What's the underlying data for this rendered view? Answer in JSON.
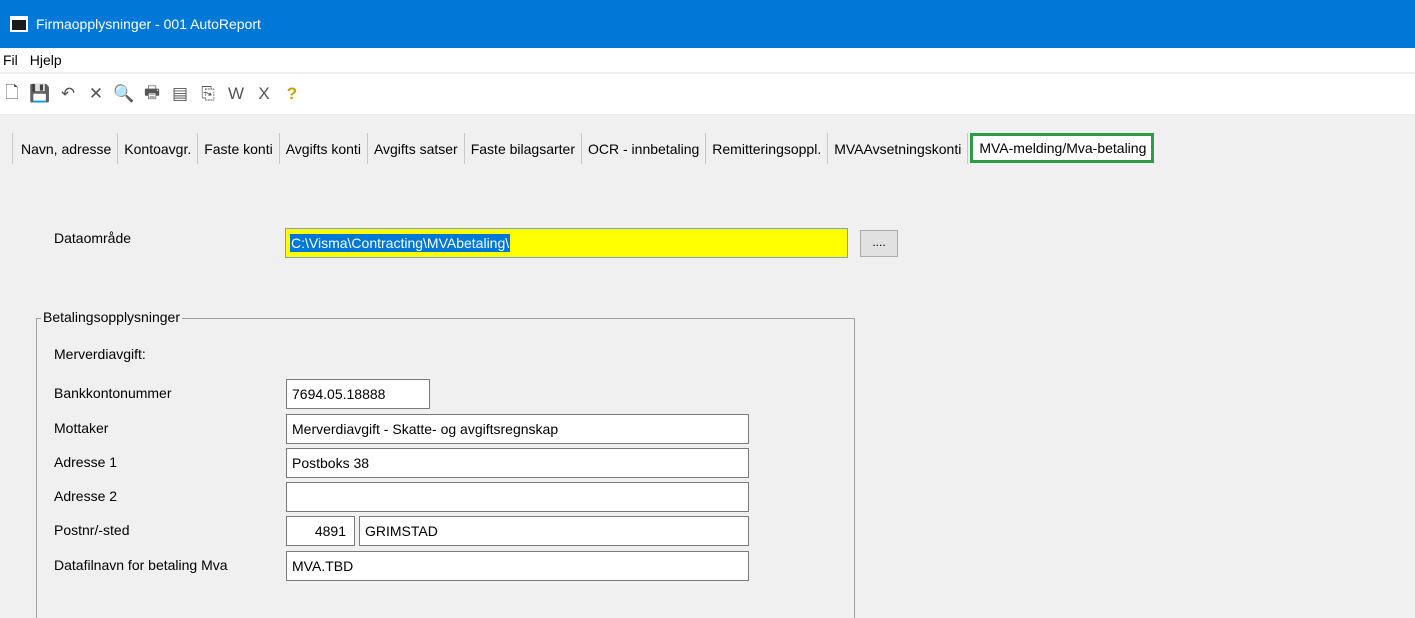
{
  "window": {
    "title": "Firmaopplysninger - 001 AutoReport"
  },
  "menu": [
    "Fil",
    "Hjelp"
  ],
  "toolbar": [
    {
      "name": "new-icon",
      "glyph": "🗋"
    },
    {
      "name": "save-icon",
      "glyph": "💾"
    },
    {
      "name": "undo-icon",
      "glyph": "↶"
    },
    {
      "name": "delete-icon",
      "glyph": "✕"
    },
    {
      "name": "find-icon",
      "glyph": "🔍"
    },
    {
      "name": "print-icon",
      "glyph": "🖶"
    },
    {
      "name": "form-icon",
      "glyph": "▤"
    },
    {
      "name": "copy-icon",
      "glyph": "⎘"
    },
    {
      "name": "word-icon",
      "glyph": "W"
    },
    {
      "name": "excel-icon",
      "glyph": "X"
    },
    {
      "name": "help-icon",
      "glyph": "?"
    }
  ],
  "tabs": [
    "Navn, adresse",
    "Kontoavgr.",
    "Faste konti",
    "Avgifts konti",
    "Avgifts satser",
    "Faste bilagsarter",
    "OCR - innbetaling",
    "Remitteringsoppl.",
    "MVAAvsetningskonti",
    "MVA-melding/Mva-betaling"
  ],
  "active_tab": "MVA-melding/Mva-betaling",
  "dataomrade": {
    "label": "Dataområde",
    "value": "C:\\Visma\\Contracting\\MVAbetaling\\",
    "browse": "...."
  },
  "group": {
    "title": "Betalingsopplysninger",
    "section": "Merverdiavgift:",
    "bankkonto": {
      "label": "Bankkontonummer",
      "value": "7694.05.18888"
    },
    "mottaker": {
      "label": "Mottaker",
      "value": "Merverdiavgift - Skatte- og avgiftsregnskap"
    },
    "adresse1": {
      "label": "Adresse 1",
      "value": "Postboks 38"
    },
    "adresse2": {
      "label": "Adresse 2",
      "value": ""
    },
    "postnr": {
      "label": "Postnr/-sted",
      "nr": "4891",
      "sted": "GRIMSTAD"
    },
    "datafil": {
      "label": "Datafilnavn for betaling Mva",
      "value": "MVA.TBD"
    }
  },
  "colors": {
    "titlebar": "#0078d7",
    "highlight": "#ffff00",
    "active_tab_border": "#2e9b48"
  }
}
